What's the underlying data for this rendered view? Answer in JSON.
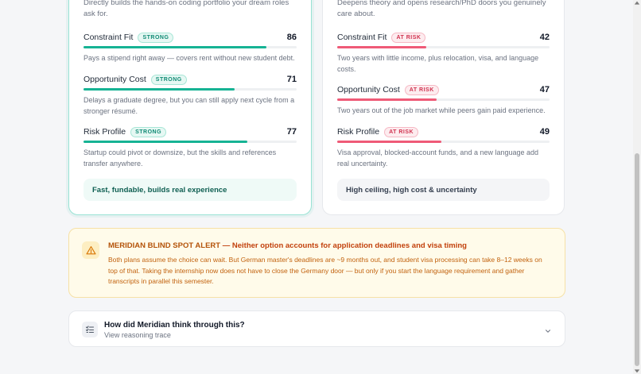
{
  "option_a": {
    "intro": "Directly builds the hands-on coding portfolio your dream roles ask for.",
    "metrics": [
      {
        "name": "Constraint Fit",
        "badge": "STRONG",
        "score": "86",
        "value": 86,
        "desc": "Pays a stipend right away — covers rent without new student debt."
      },
      {
        "name": "Opportunity Cost",
        "badge": "STRONG",
        "score": "71",
        "value": 71,
        "desc": "Delays a graduate degree, but you can still apply next cycle from a stronger résumé."
      },
      {
        "name": "Risk Profile",
        "badge": "STRONG",
        "score": "77",
        "value": 77,
        "desc": "Startup could pivot or downsize, but the skills and references transfer anywhere."
      }
    ],
    "summary": "Fast, fundable, builds real experience"
  },
  "option_b": {
    "intro": "Deepens theory and opens research/PhD doors you genuinely care about.",
    "metrics": [
      {
        "name": "Constraint Fit",
        "badge": "AT RISK",
        "score": "42",
        "value": 42,
        "desc": "Two years with little income, plus relocation, visa, and language costs."
      },
      {
        "name": "Opportunity Cost",
        "badge": "AT RISK",
        "score": "47",
        "value": 47,
        "desc": "Two years out of the job market while peers gain paid experience."
      },
      {
        "name": "Risk Profile",
        "badge": "AT RISK",
        "score": "49",
        "value": 49,
        "desc": "Visa approval, blocked-account funds, and a new language add real uncertainty."
      }
    ],
    "summary": "High ceiling, high cost & uncertainty"
  },
  "alert": {
    "title": "MERIDIAN BLIND SPOT ALERT",
    "subtitle": " — Neither option accounts for application deadlines and visa timing",
    "body": "Both plans assume the choice can wait. But German master's deadlines are ~9 months out, and student visa processing can take 8–12 weeks on top of that. Taking the internship now does not have to close the Germany door — but only if you start the language requirement and gather transcripts in parallel this semester.",
    "icon": "warning-icon"
  },
  "trace": {
    "title": "How did Meridian think through this?",
    "subtitle": "View reasoning trace",
    "icon": "list-check-icon"
  },
  "colors": {
    "teal": "#16b394",
    "red": "#ef5a77",
    "alert_bg": "#fffbea",
    "alert_text": "#b45309"
  }
}
